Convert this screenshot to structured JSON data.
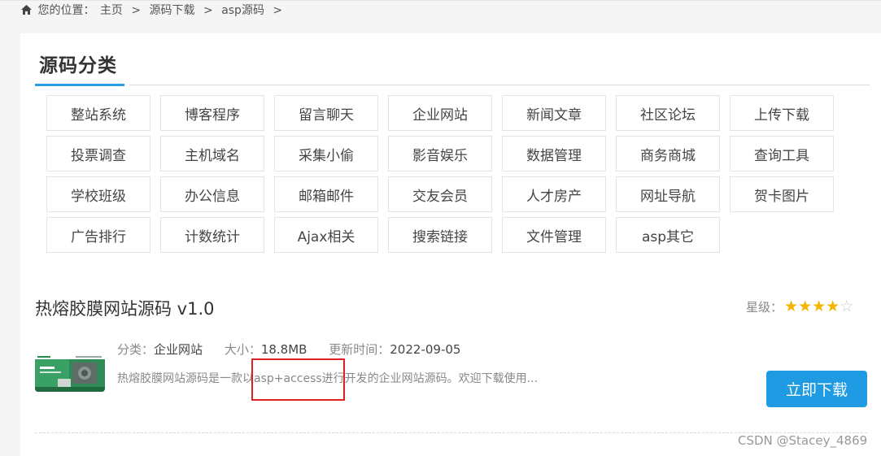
{
  "breadcrumb": {
    "prefix": "您的位置：",
    "items": [
      "主页",
      "源码下载",
      "asp源码"
    ],
    "separator": ">"
  },
  "category_section": {
    "title": "源码分类",
    "items": [
      "整站系统",
      "博客程序",
      "留言聊天",
      "企业网站",
      "新闻文章",
      "社区论坛",
      "上传下载",
      "投票调查",
      "主机域名",
      "采集小偷",
      "影音娱乐",
      "数据管理",
      "商务商城",
      "查询工具",
      "学校班级",
      "办公信息",
      "邮箱邮件",
      "交友会员",
      "人才房产",
      "网址导航",
      "贺卡图片",
      "广告排行",
      "计数统计",
      "Ajax相关",
      "搜索链接",
      "文件管理",
      "asp其它"
    ]
  },
  "item": {
    "title": "热熔胶膜网站源码 v1.0",
    "rating_label": "星级：",
    "rating": 4,
    "rating_max": 5,
    "category_label": "分类：",
    "category": "企业网站",
    "size_label": "大小：",
    "size": "18.8MB",
    "updated_label": "更新时间：",
    "updated": "2022-09-05",
    "description": "热熔胶膜网站源码是一款以asp+access进行开发的企业网站源码。欢迎下载使用...",
    "download_label": "立即下载"
  },
  "watermark": "CSDN @Stacey_4869",
  "colors": {
    "accent": "#1e9be2",
    "star": "#f4b400",
    "highlight": "#e02020"
  }
}
